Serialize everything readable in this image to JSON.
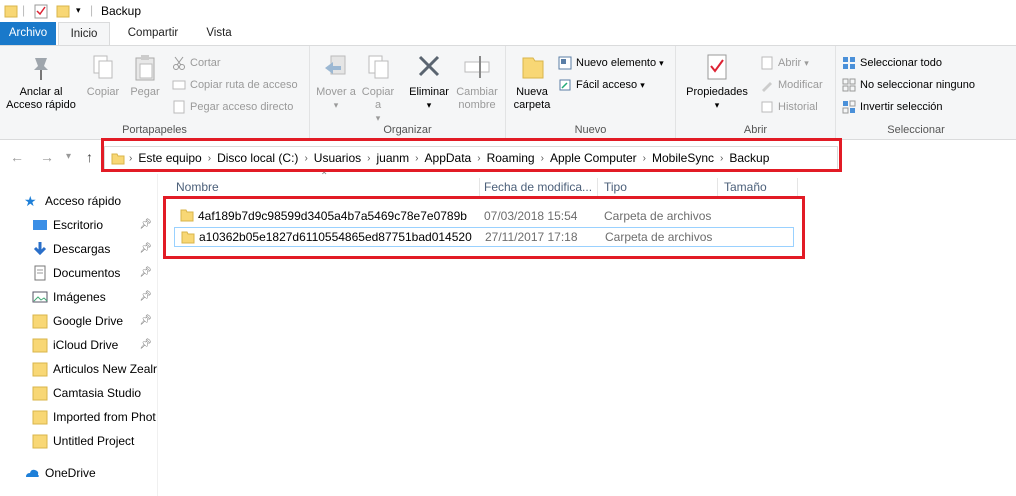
{
  "window": {
    "title": "Backup"
  },
  "tabs": [
    "Archivo",
    "Inicio",
    "Compartir",
    "Vista"
  ],
  "ribbon": {
    "portapapeles": {
      "label": "Portapapeles",
      "anclar": "Anclar al Acceso rápido",
      "copiar": "Copiar",
      "pegar": "Pegar",
      "cortar": "Cortar",
      "copiar_ruta": "Copiar ruta de acceso",
      "pegar_acceso": "Pegar acceso directo"
    },
    "organizar": {
      "label": "Organizar",
      "mover": "Mover a",
      "copiar": "Copiar a",
      "eliminar": "Eliminar",
      "cambiar": "Cambiar nombre"
    },
    "nuevo": {
      "label": "Nuevo",
      "nueva_carpeta": "Nueva carpeta",
      "nuevo_elemento": "Nuevo elemento",
      "facil_acceso": "Fácil acceso"
    },
    "abrir": {
      "label": "Abrir",
      "propiedades": "Propiedades",
      "abrir": "Abrir",
      "modificar": "Modificar",
      "historial": "Historial"
    },
    "seleccionar": {
      "label": "Seleccionar",
      "todo": "Seleccionar todo",
      "ninguno": "No seleccionar ninguno",
      "invertir": "Invertir selección"
    }
  },
  "address": {
    "crumbs": [
      "Este equipo",
      "Disco local (C:)",
      "Usuarios",
      "juanm",
      "AppData",
      "Roaming",
      "Apple Computer",
      "MobileSync",
      "Backup"
    ]
  },
  "nav": {
    "quick_access": "Acceso rápido",
    "items": [
      "Escritorio",
      "Descargas",
      "Documentos",
      "Imágenes",
      "Google Drive",
      "iCloud Drive",
      "Articulos New Zealr",
      "Camtasia Studio",
      "Imported from Phot",
      "Untitled Project"
    ],
    "onedrive": "OneDrive"
  },
  "columns": [
    "Nombre",
    "Fecha de modifica...",
    "Tipo",
    "Tamaño"
  ],
  "files": [
    {
      "name": "4af189b7d9c98599d3405a4b7a5469c78e7e0789b",
      "date": "07/03/2018 15:54",
      "type": "Carpeta de archivos"
    },
    {
      "name": "a10362b05e1827d6110554865ed87751bad014520",
      "date": "27/11/2017 17:18",
      "type": "Carpeta de archivos"
    }
  ],
  "colors": {
    "highlight": "#e21b25",
    "file_tab": "#1979ca",
    "folder": "#f8d775"
  }
}
